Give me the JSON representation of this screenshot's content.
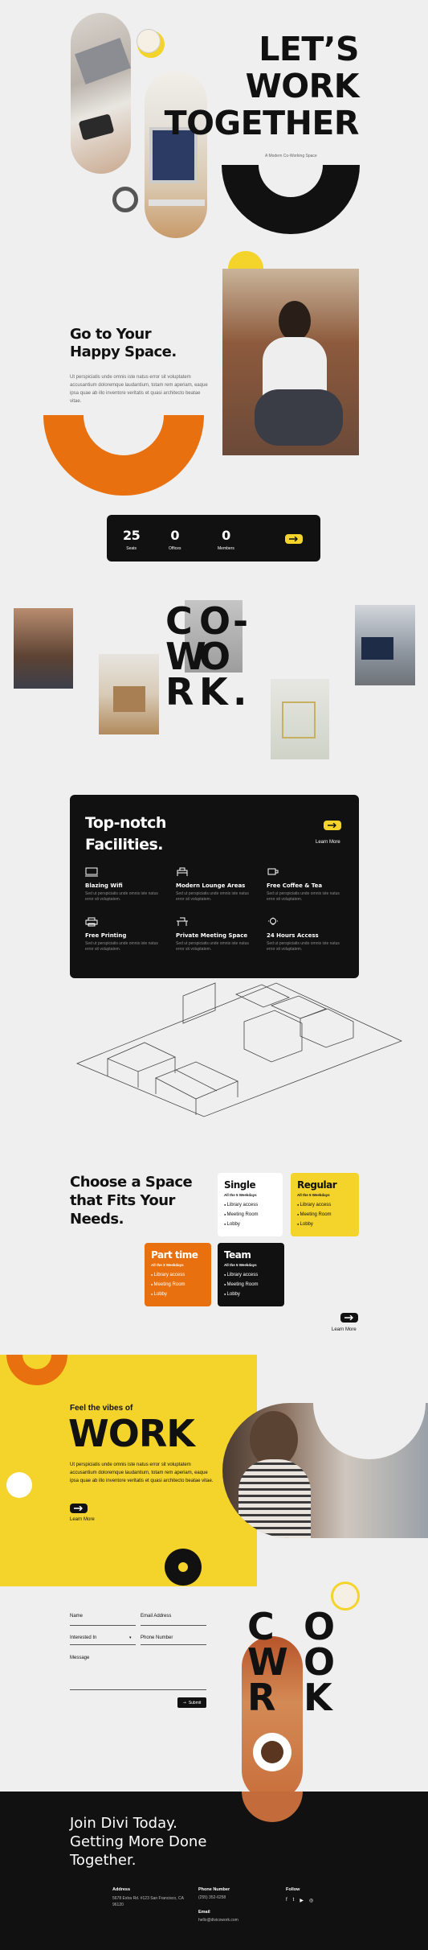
{
  "hero": {
    "title_lines": [
      "LET’S",
      "WORK",
      "TOGETHER"
    ],
    "subtitle": "A Modern Co-Working Space"
  },
  "happy": {
    "title_lines": [
      "Go to Your",
      "Happy Space."
    ],
    "body": "Ut perspiciatis unde omnis iste natus error sit voluptatem accusantium doloremque laudantium, totam rem aperiam, eaque ipsa quae ab illo inventore veritatis et quasi architecto beatae vitae."
  },
  "stats": {
    "items": [
      {
        "value": "25",
        "label": "Seats"
      },
      {
        "value": "0",
        "label": "Offices"
      },
      {
        "value": "0",
        "label": "Members"
      }
    ],
    "arrow_icon": "arrow-right-icon"
  },
  "cowork_mid": {
    "letters": [
      "C",
      "O",
      "-",
      "W",
      "O",
      "R",
      "K",
      "."
    ]
  },
  "facilities": {
    "title_lines": [
      "Top-notch",
      "Facilities."
    ],
    "learn_more": "Learn More",
    "features": [
      {
        "icon": "wifi-icon",
        "title": "Blazing Wifi",
        "desc": "Sed ut perspiciatis unde omnis iste natus error sit voluptatem."
      },
      {
        "icon": "lounge-icon",
        "title": "Modern Lounge Areas",
        "desc": "Sed ut perspiciatis unde omnis iste natus error sit voluptatem."
      },
      {
        "icon": "coffee-icon",
        "title": "Free Coffee & Tea",
        "desc": "Sed ut perspiciatis unde omnis iste natus error sit voluptatem."
      },
      {
        "icon": "printer-icon",
        "title": "Free Printing",
        "desc": "Sed ut perspiciatis unde omnis iste natus error sit voluptatem."
      },
      {
        "icon": "meeting-icon",
        "title": "Private Meeting Space",
        "desc": "Sed ut perspiciatis unde omnis iste natus error sit voluptatem."
      },
      {
        "icon": "bulb-icon",
        "title": "24 Hours Access",
        "desc": "Sed ut perspiciatis unde omnis iste natus error sit voluptatem."
      }
    ]
  },
  "spaces": {
    "title_lines": [
      "Choose a Space",
      "that Fits Your",
      "Needs."
    ],
    "cards": [
      {
        "name": "Single",
        "sub": "All the 5 Weekdays",
        "items": [
          "Library access",
          "Meeting Room",
          "Lobby"
        ],
        "bg": "#ffffff",
        "fg": "#111111"
      },
      {
        "name": "Regular",
        "sub": "All the 5 Weekdays",
        "items": [
          "Library access",
          "Meeting Room",
          "Lobby"
        ],
        "bg": "#f4d42b",
        "fg": "#111111"
      },
      {
        "name": "Part time",
        "sub": "All the 3 Weekdays",
        "items": [
          "Library access",
          "Meeting Room",
          "Lobby"
        ],
        "bg": "#e8700f",
        "fg": "#ffffff"
      },
      {
        "name": "Team",
        "sub": "All the 5 Weekdays",
        "items": [
          "Library access",
          "Meeting Room",
          "Lobby"
        ],
        "bg": "#111111",
        "fg": "#ffffff"
      }
    ],
    "learn_more": "Learn More"
  },
  "vibes": {
    "kicker": "Feel the vibes of",
    "title": "WORK",
    "body": "Ut perspiciatis unde omnis iste natus error sit voluptatem accusantium doloremque laudantium, totam rem aperiam, eaque ipsa quae ab illo inventore veritatis et quasi architecto beatae vitae.",
    "learn_more": "Learn More"
  },
  "contact": {
    "name": "Name",
    "email": "Email Address",
    "interested": "Interested In",
    "phone": "Phone Number",
    "message": "Message",
    "submit": "Submit",
    "cowork_letters": [
      "C",
      "O",
      "W",
      "O",
      "R",
      "K"
    ]
  },
  "footer": {
    "title_lines": [
      "Join Divi Today.",
      "Getting More Done",
      "Together."
    ],
    "address_label": "Address",
    "address": "5678 Extra Rd. #123 San Francisco, CA 96120",
    "phone_label": "Phone Number",
    "phone": "(255) 352-6258",
    "email_label": "Email",
    "email": "hello@divicowork.com",
    "follow_label": "Follow",
    "social": [
      "f",
      "t",
      "▶",
      "◎"
    ]
  },
  "colors": {
    "yellow": "#f4d42b",
    "orange": "#e8700f",
    "black": "#111111",
    "bg": "#efefef"
  }
}
